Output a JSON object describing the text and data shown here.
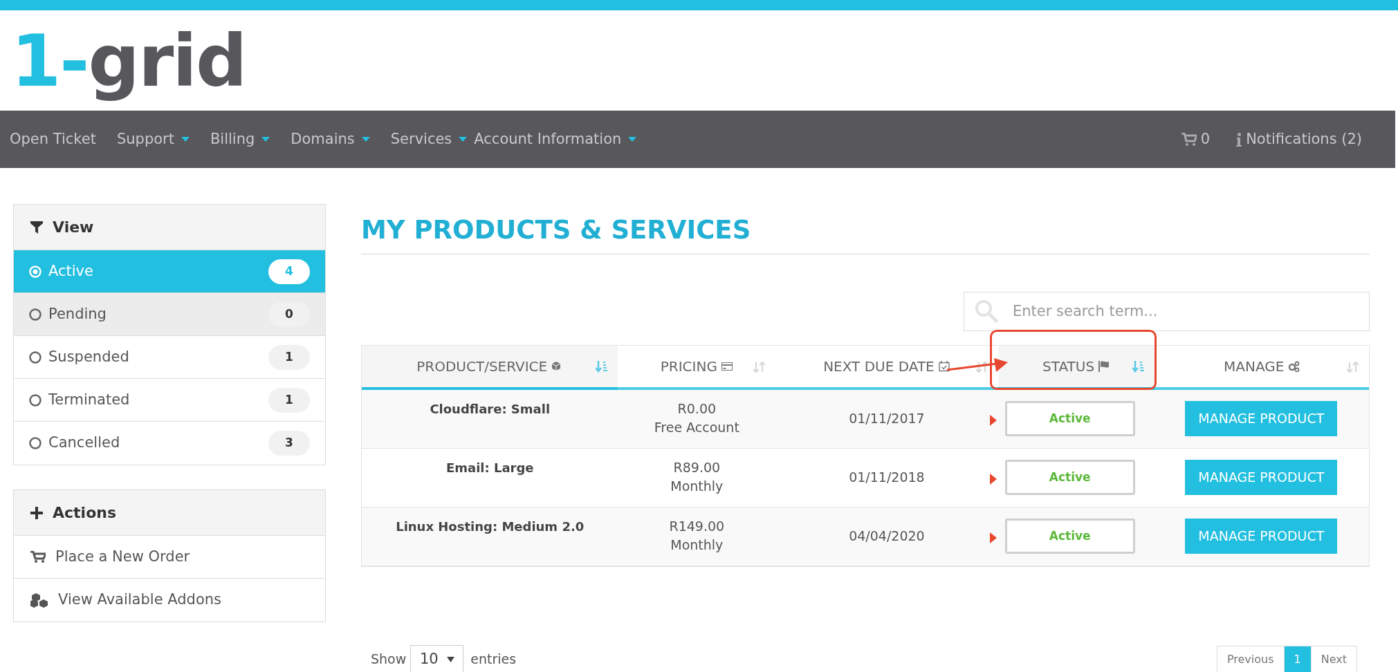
{
  "logo": {
    "accent": "1-",
    "text": "grid"
  },
  "nav": {
    "items": [
      {
        "label": "Open Ticket",
        "dropdown": false
      },
      {
        "label": "Support",
        "dropdown": true
      },
      {
        "label": "Billing",
        "dropdown": true
      },
      {
        "label": "Domains",
        "dropdown": true
      },
      {
        "label": "Services",
        "dropdown": true
      },
      {
        "label": "Account Information",
        "dropdown": true
      }
    ],
    "cart_count": "0",
    "notifications": "Notifications (2)"
  },
  "sidebar": {
    "view": {
      "title": "View",
      "items": [
        {
          "label": "Active",
          "count": "4",
          "selected": true,
          "hovered": false
        },
        {
          "label": "Pending",
          "count": "0",
          "selected": false,
          "hovered": true
        },
        {
          "label": "Suspended",
          "count": "1",
          "selected": false,
          "hovered": false
        },
        {
          "label": "Terminated",
          "count": "1",
          "selected": false,
          "hovered": false
        },
        {
          "label": "Cancelled",
          "count": "3",
          "selected": false,
          "hovered": false
        }
      ]
    },
    "actions": {
      "title": "Actions",
      "items": [
        {
          "label": "Place a New Order"
        },
        {
          "label": "View Available Addons"
        }
      ]
    }
  },
  "page_title": "MY PRODUCTS & SERVICES",
  "search": {
    "placeholder": "Enter search term..."
  },
  "table": {
    "columns": [
      {
        "label": "PRODUCT/SERVICE",
        "sorted": true,
        "highlighted": false
      },
      {
        "label": "PRICING",
        "sorted": false,
        "highlighted": false
      },
      {
        "label": "NEXT DUE DATE",
        "sorted": false,
        "highlighted": false
      },
      {
        "label": "STATUS",
        "sorted": true,
        "highlighted": true
      },
      {
        "label": "MANAGE",
        "sorted": false,
        "highlighted": false
      }
    ],
    "rows": [
      {
        "product": "Cloudflare: Small",
        "price": "R0.00",
        "cycle": "Free Account",
        "due": "01/11/2017",
        "status": "Active",
        "marked": true,
        "action": "MANAGE PRODUCT"
      },
      {
        "product": "Email: Large",
        "price": "R89.00",
        "cycle": "Monthly",
        "due": "01/11/2018",
        "status": "Active",
        "marked": true,
        "action": "MANAGE PRODUCT"
      },
      {
        "product": "Linux Hosting: Medium 2.0",
        "price": "R149.00",
        "cycle": "Monthly",
        "due": "04/04/2020",
        "status": "Active",
        "marked": true,
        "action": "MANAGE PRODUCT"
      }
    ]
  },
  "footer": {
    "show_label": "Show",
    "page_size": "10",
    "entries_label": "entries",
    "pages": [
      {
        "label": "Previous",
        "selected": false
      },
      {
        "label": "1",
        "selected": true
      },
      {
        "label": "Next",
        "selected": false
      }
    ]
  }
}
